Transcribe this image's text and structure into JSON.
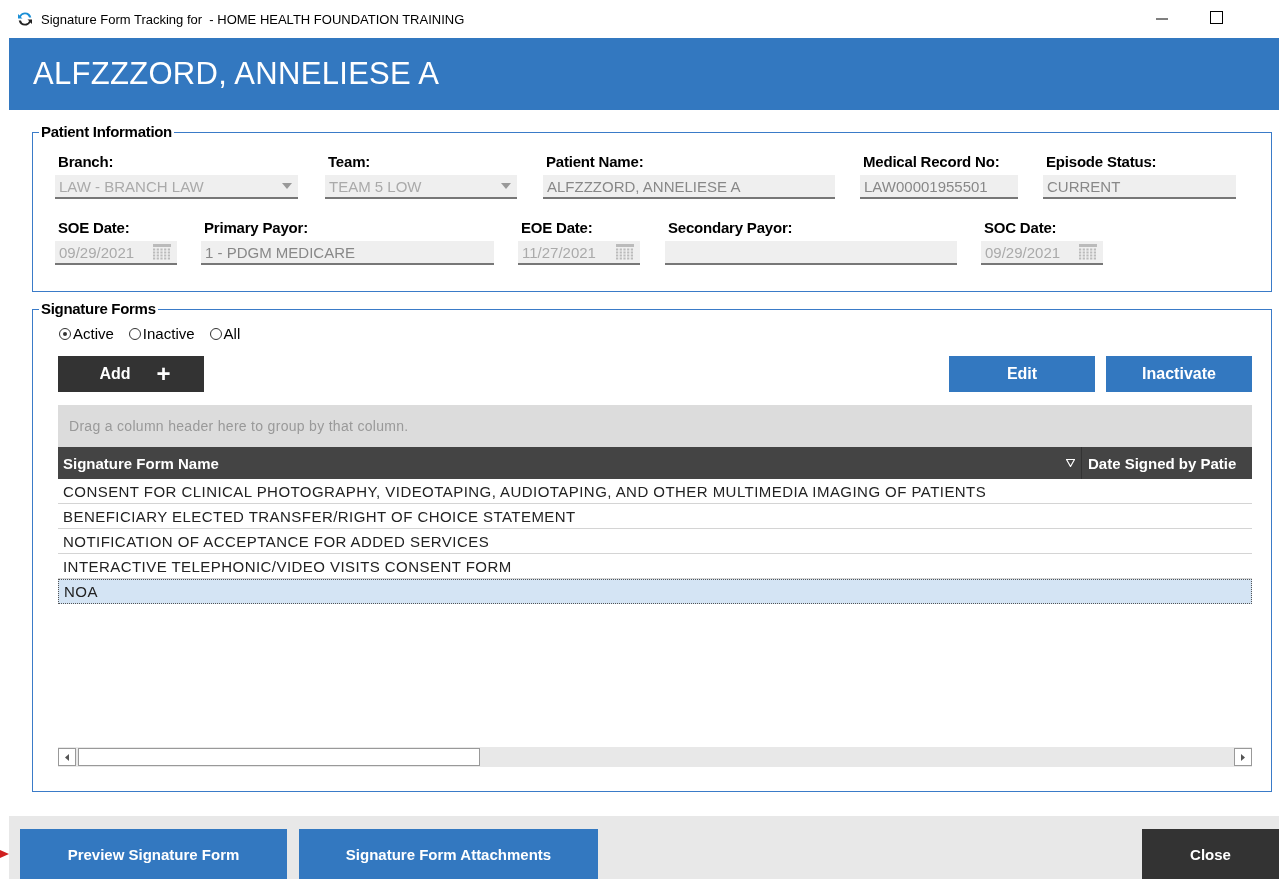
{
  "window": {
    "title": "Signature Form Tracking for  - HOME HEALTH FOUNDATION TRAINING"
  },
  "header": {
    "patient": "ALFZZZORD, ANNELIESE A"
  },
  "patient_information": {
    "title": "Patient Information",
    "rows": [
      [
        {
          "label": "Branch:",
          "kind": "select",
          "value": "LAW - BRANCH LAW"
        },
        {
          "label": "Team:",
          "kind": "select",
          "value": "TEAM 5 LOW"
        },
        {
          "label": "Patient Name:",
          "kind": "text",
          "value": "ALFZZZORD, ANNELIESE A"
        },
        {
          "label": "Medical Record No:",
          "kind": "text",
          "value": "LAW00001955501"
        },
        {
          "label": "Episode Status:",
          "kind": "text",
          "value": "CURRENT"
        }
      ],
      [
        {
          "label": "SOE Date:",
          "kind": "date",
          "value": "09/29/2021"
        },
        {
          "label": "Primary Payor:",
          "kind": "text",
          "value": "1 - PDGM MEDICARE"
        },
        {
          "label": "EOE Date:",
          "kind": "date",
          "value": "11/27/2021"
        },
        {
          "label": "Secondary Payor:",
          "kind": "text"
        },
        {
          "label": "SOC Date:",
          "kind": "date",
          "value": "09/29/2021"
        }
      ]
    ]
  },
  "signature_forms": {
    "title": "Signature Forms",
    "filters": [
      {
        "label": "Active",
        "selected": true
      },
      {
        "label": "Inactive",
        "selected": false
      },
      {
        "label": "All",
        "selected": false
      }
    ],
    "add_button": "Add",
    "add_icon": "+",
    "edit_button": "Edit",
    "inactivate_button": "Inactivate",
    "group_panel": {
      "placeholder": "Drag a column header here to group by that column."
    },
    "columns": [
      "Signature Form Name",
      "Date Signed by Patie"
    ],
    "rows": [
      {
        "name": "CONSENT FOR CLINICAL PHOTOGRAPHY, VIDEOTAPING, AUDIOTAPING, AND OTHER MULTIMEDIA IMAGING OF PATIENTS",
        "selected": false
      },
      {
        "name": "BENEFICIARY ELECTED TRANSFER/RIGHT OF CHOICE STATEMENT",
        "selected": false
      },
      {
        "name": "NOTIFICATION OF ACCEPTANCE FOR ADDED SERVICES",
        "selected": false
      },
      {
        "name": "INTERACTIVE TELEPHONIC/VIDEO VISITS CONSENT FORM",
        "selected": false
      },
      {
        "name": "NOA",
        "selected": true
      }
    ]
  },
  "footer": {
    "buttons": [
      "Preview Signature Form",
      "Signature Form Attachments"
    ],
    "close": "Close"
  }
}
